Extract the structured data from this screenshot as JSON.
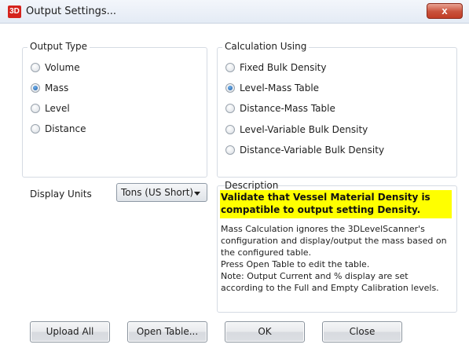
{
  "window": {
    "title": "Output Settings...",
    "icon_text": "3D",
    "close_glyph": "x"
  },
  "output_type": {
    "title": "Output Type",
    "options": [
      {
        "label": "Volume",
        "checked": false
      },
      {
        "label": "Mass",
        "checked": true
      },
      {
        "label": "Level",
        "checked": false
      },
      {
        "label": "Distance",
        "checked": false
      }
    ]
  },
  "calculation": {
    "title": "Calculation Using",
    "options": [
      {
        "label": "Fixed Bulk Density",
        "checked": false
      },
      {
        "label": "Level-Mass Table",
        "checked": true
      },
      {
        "label": "Distance-Mass Table",
        "checked": false
      },
      {
        "label": "Level-Variable Bulk Density",
        "checked": false
      },
      {
        "label": "Distance-Variable Bulk Density",
        "checked": false
      }
    ]
  },
  "display_units": {
    "label": "Display Units",
    "selected": "Tons (US Short)"
  },
  "description": {
    "title": "Description",
    "warning_lines": [
      "Validate that Vessel Material Density is",
      "compatible to output setting Density."
    ],
    "highlight_color": "#ffff00",
    "body_lines": [
      "Mass Calculation ignores the 3DLevelScanner's",
      "configuration and display/output the mass based on",
      "the configured table.",
      "Press Open Table to edit the table.",
      "Note: Output Current and % display are set",
      "according to the Full and Empty Calibration levels."
    ]
  },
  "buttons": {
    "upload_all": "Upload All",
    "open_table": "Open Table...",
    "ok": "OK",
    "close": "Close"
  }
}
